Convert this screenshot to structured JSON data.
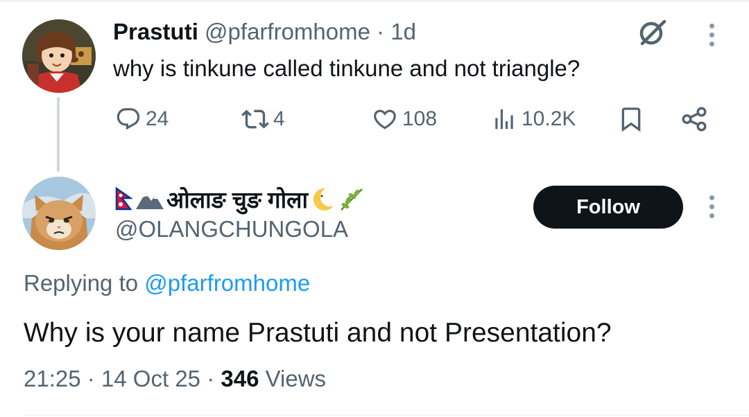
{
  "parent_tweet": {
    "display_name": "Prastuti",
    "handle": "@pfarfromhome",
    "separator": "·",
    "time": "1d",
    "text": "why is tinkune called tinkune and not triangle?",
    "actions": {
      "replies": "24",
      "reposts": "4",
      "likes": "108",
      "views": "10.2K"
    },
    "icons": [
      "grok-icon",
      "more-icon",
      "reply-icon",
      "repost-icon",
      "like-icon",
      "views-icon",
      "bookmark-icon",
      "share-icon"
    ]
  },
  "reply_tweet": {
    "display_name": "ओलाङ चुङ गोला",
    "name_emojis": [
      "nepal-flag",
      "mountain",
      "crescent-moon-face",
      "herb"
    ],
    "handle": "@OLANGCHUNGOLA",
    "follow_label": "Follow",
    "replying_prefix": "Replying to",
    "replying_mention": "@pfarfromhome",
    "text": "Why is your name Prastuti and not Presentation?",
    "timestamp": "21:25",
    "date": "14 Oct 25",
    "separator": "·",
    "views_count": "346",
    "views_label": "Views"
  },
  "colors": {
    "text": "#0f1419",
    "secondary": "#536471",
    "link": "#1d9bf0",
    "follow_bg": "#0f1419",
    "thread_line": "#cfd9de"
  }
}
